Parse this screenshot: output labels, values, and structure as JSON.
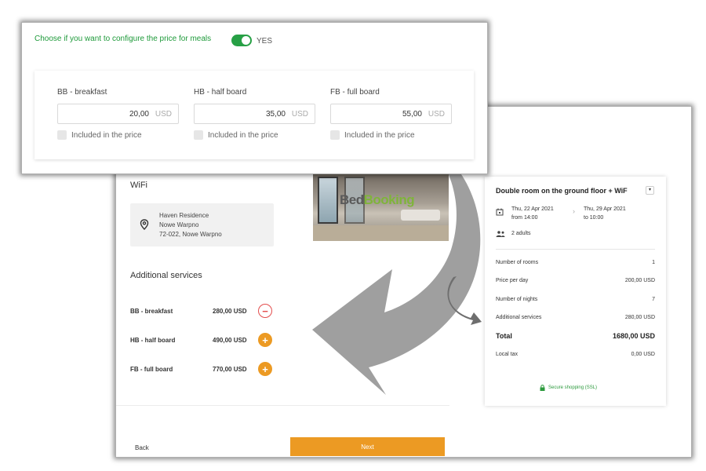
{
  "front_panel": {
    "question": "Choose if you want to configure the price for meals",
    "toggle_label": "YES",
    "meals": [
      {
        "label": "BB - breakfast",
        "value": "20,00",
        "currency": "USD",
        "included_label": "Included in the price"
      },
      {
        "label": "HB - half board",
        "value": "35,00",
        "currency": "USD",
        "included_label": "Included in the price"
      },
      {
        "label": "FB - full board",
        "value": "55,00",
        "currency": "USD",
        "included_label": "Included in the price"
      }
    ]
  },
  "left": {
    "wifi": "WiFi",
    "address": {
      "name": "Haven Residence",
      "city": "Nowe Warpno",
      "postal": "72-022, Nowe Warpno"
    },
    "photo_brand": {
      "part1": "Bed",
      "part2": "Booking"
    },
    "additional_title": "Additional services",
    "services": [
      {
        "name": "BB - breakfast",
        "price": "280,00 USD",
        "action": "−"
      },
      {
        "name": "HB - half board",
        "price": "490,00 USD",
        "action": "+"
      },
      {
        "name": "FB - full board",
        "price": "770,00 USD",
        "action": "+"
      }
    ],
    "back_label": "Back",
    "next_label": "Next"
  },
  "summary": {
    "room_title": "Double room on the ground floor + WiF",
    "checkin_date": "Thu, 22 Apr 2021",
    "checkin_time": "from 14:00",
    "checkout_date": "Thu, 29 Apr 2021",
    "checkout_time": "to 10:00",
    "guests": "2 adults",
    "rows": [
      {
        "label": "Number of rooms",
        "value": "1"
      },
      {
        "label": "Price per day",
        "value": "200,00 USD"
      },
      {
        "label": "Number of nights",
        "value": "7"
      },
      {
        "label": "Additional services",
        "value": "280,00 USD"
      },
      {
        "label": "Total",
        "value": "1680,00 USD"
      },
      {
        "label": "Local tax",
        "value": "0,00 USD"
      }
    ],
    "ssl": "Secure shopping (SSL)"
  },
  "colors": {
    "accent_orange": "#ec9a23",
    "green": "#27a045",
    "red": "#e34d4d"
  }
}
